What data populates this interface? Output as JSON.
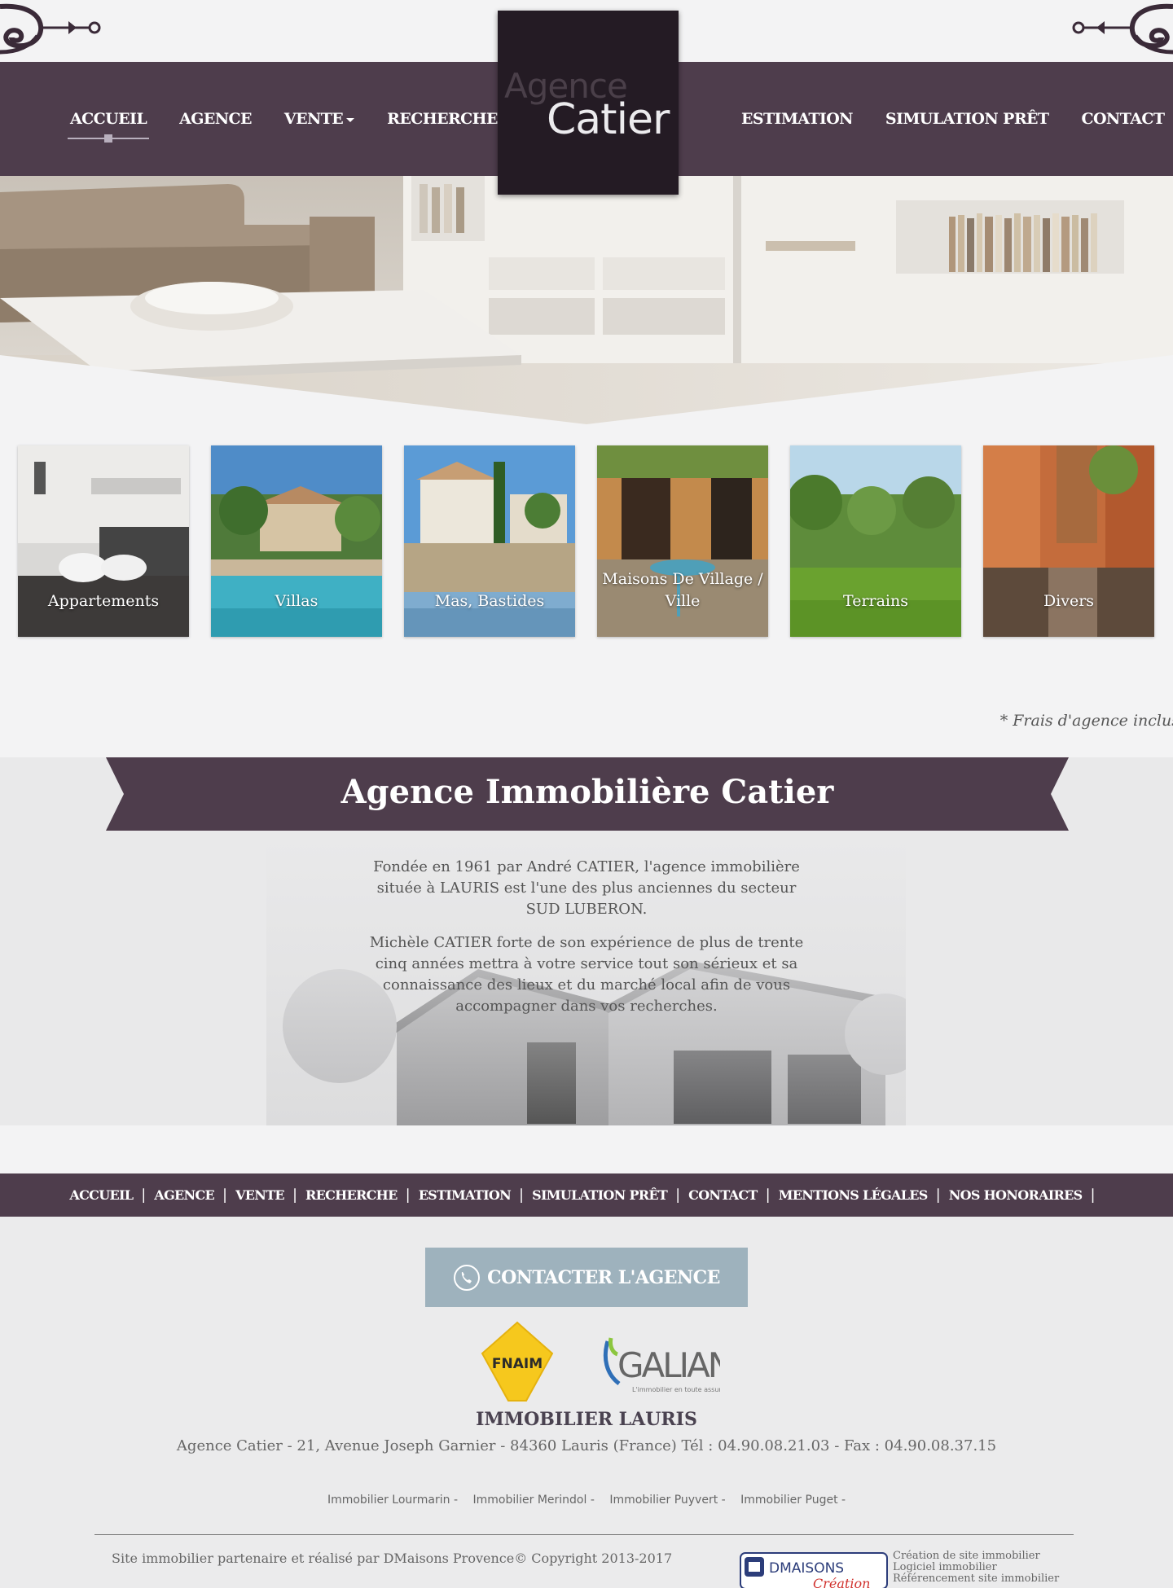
{
  "brand": {
    "logo_line1": "Agence",
    "logo_line2": "Catier"
  },
  "nav": {
    "left": [
      {
        "label": "ACCUEIL",
        "active": true
      },
      {
        "label": "AGENCE"
      },
      {
        "label": "VENTE"
      },
      {
        "label": "RECHERCHE"
      }
    ],
    "right": [
      {
        "label": "ESTIMATION"
      },
      {
        "label": "SIMULATION PRÊT"
      },
      {
        "label": "CONTACT"
      }
    ]
  },
  "categories": [
    {
      "label": "Appartements"
    },
    {
      "label": "Villas"
    },
    {
      "label": "Mas, Bastides"
    },
    {
      "label": "Maisons De Village / Ville"
    },
    {
      "label": "Terrains"
    },
    {
      "label": "Divers"
    }
  ],
  "fees_note": "* Frais d'agence inclus",
  "about": {
    "title": "Agence Immobilière Catier",
    "paragraph1": "Fondée en 1961 par André CATIER, l'agence immobilière située à LAURIS est l'une des plus anciennes du secteur SUD LUBERON.",
    "paragraph2": "Michèle CATIER forte de son expérience de plus de trente cinq années mettra à votre service tout son sérieux et sa connaissance des lieux et du marché local afin de vous accompagner dans vos recherches."
  },
  "footer_nav": [
    "ACCUEIL",
    "AGENCE",
    "VENTE",
    "RECHERCHE",
    "ESTIMATION",
    "SIMULATION PRÊT",
    "CONTACT",
    "MENTIONS LÉGALES",
    "NOS HONORAIRES"
  ],
  "footer": {
    "contact_button": "CONTACTER L'AGENCE",
    "fnaim_text": "FNAIM",
    "galian_text": "GALIAN",
    "galian_tagline": "L'immobilier en toute assurance",
    "immo_title": "IMMOBILIER LAURIS",
    "address": "Agence Catier - 21, Avenue Joseph Garnier - 84360 Lauris (France) Tél : 04.90.08.21.03 - Fax : 04.90.08.37.15",
    "cities": [
      "Immobilier Lourmarin -",
      "Immobilier Merindol -",
      "Immobilier Puyvert -",
      "Immobilier Puget -"
    ],
    "copyright": "Site immobilier partenaire et réalisé par DMaisons Provence© Copyright  2013-2017",
    "dm_logo_text": "DMAISONS",
    "dm_logo_sub": "Création",
    "dm_links": [
      "Création de site immobilier",
      "Logiciel immobilier",
      "Référencement site immobilier"
    ]
  }
}
